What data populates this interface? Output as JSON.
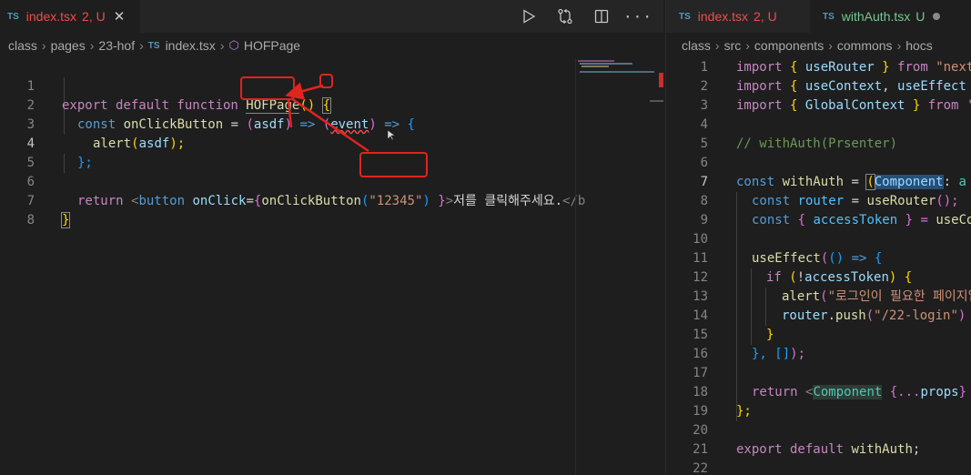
{
  "left": {
    "tabs": [
      {
        "lang": "TS",
        "name": "index.tsx",
        "status": "2, U"
      }
    ],
    "actions": [
      "run-icon",
      "compare-changes-icon",
      "split-editor-icon",
      "more-actions-icon"
    ],
    "breadcrumb": [
      "class",
      "pages",
      "23-hof",
      "index.tsx",
      "HOFPage"
    ],
    "line_numbers": [
      "1",
      "2",
      "3",
      "4",
      "5",
      "6",
      "7",
      "8"
    ],
    "code": {
      "l1": {
        "a": "export default function ",
        "b": "HOFPage",
        "c": "() ",
        "d": "{"
      },
      "l2": {
        "a": "const ",
        "b": "onClickButton",
        "c": " = ",
        "d": "(",
        "e": "asdf",
        "f": ") ",
        "g": "=>",
        "h": " ",
        "i": "(",
        "j": "event",
        "k": ")",
        "l": " => ",
        "m": "{"
      },
      "l3": {
        "a": "alert",
        "b": "(",
        "c": "asdf",
        "d": ");"
      },
      "l4": {
        "a": "};"
      },
      "l6": {
        "a": "return ",
        "b": "<",
        "c": "button",
        "d": " ",
        "e": "onClick",
        "f": "=",
        "g": "{",
        "h": "onClickButton",
        "i": "(",
        "j": "\"12345\"",
        "k": ")",
        "l": " }",
        "m": ">",
        "n": "저를 클릭해주세요.",
        "o": "</b"
      },
      "l7": {
        "a": "}"
      }
    }
  },
  "right": {
    "tabs": [
      {
        "lang": "TS",
        "name": "index.tsx",
        "status": "2, U"
      },
      {
        "lang": "TS",
        "name": "withAuth.tsx",
        "status": "U"
      }
    ],
    "breadcrumb": [
      "class",
      "src",
      "components",
      "commons",
      "hocs"
    ],
    "line_numbers": [
      "1",
      "2",
      "3",
      "4",
      "5",
      "6",
      "7",
      "8",
      "9",
      "10",
      "11",
      "12",
      "13",
      "14",
      "15",
      "16",
      "17",
      "18",
      "19",
      "20",
      "21",
      "22"
    ],
    "code": {
      "l1": {
        "a": "import ",
        "b": "{ ",
        "c": "useRouter",
        "d": " } ",
        "e": "from ",
        "f": "\"next"
      },
      "l2": {
        "a": "import ",
        "b": "{ ",
        "c": "useContext",
        "d": ", ",
        "e": "useEffect"
      },
      "l3": {
        "a": "import ",
        "b": "{ ",
        "c": "GlobalContext",
        "d": " } ",
        "e": "from ",
        "f": "'"
      },
      "l5": {
        "a": "// withAuth(Prsenter)"
      },
      "l7": {
        "a": "const ",
        "b": "withAuth",
        "c": " = ",
        "d": "(",
        "e": "Component",
        "f": ": ",
        "g": "a"
      },
      "l8": {
        "a": "const ",
        "b": "router",
        "c": " = ",
        "d": "useRouter",
        "e": "();"
      },
      "l9": {
        "a": "const ",
        "b": "{ ",
        "c": "accessToken",
        "d": " } = ",
        "e": "useCo"
      },
      "l11": {
        "a": "useEffect",
        "b": "(",
        "c": "() ",
        "d": "=>",
        "e": " {"
      },
      "l12": {
        "a": "if ",
        "b": "(",
        "c": "!",
        "d": "accessToken",
        "e": ") ",
        "f": "{"
      },
      "l13": {
        "a": "alert",
        "b": "(",
        "c": "\"로그인이 필요한 페이지입"
      },
      "l14": {
        "a": "router",
        "b": ".",
        "c": "push",
        "d": "(",
        "e": "\"/22-login\"",
        "f": ")"
      },
      "l15": {
        "a": "}"
      },
      "l16": {
        "a": "}, ",
        "b": "[]",
        "c": ");"
      },
      "l18": {
        "a": "return ",
        "b": "<",
        "c": "Component",
        "d": " ",
        "e": "{...",
        "f": "props",
        "g": "}"
      },
      "l19": {
        "a": "};"
      },
      "l21": {
        "a": "export default ",
        "b": "withAuth",
        "c": ";"
      }
    }
  },
  "colors": {
    "error": "#f14c4c",
    "annotation": "#e0241f",
    "untracked": "#73c991",
    "keyword": "#569cd6"
  }
}
